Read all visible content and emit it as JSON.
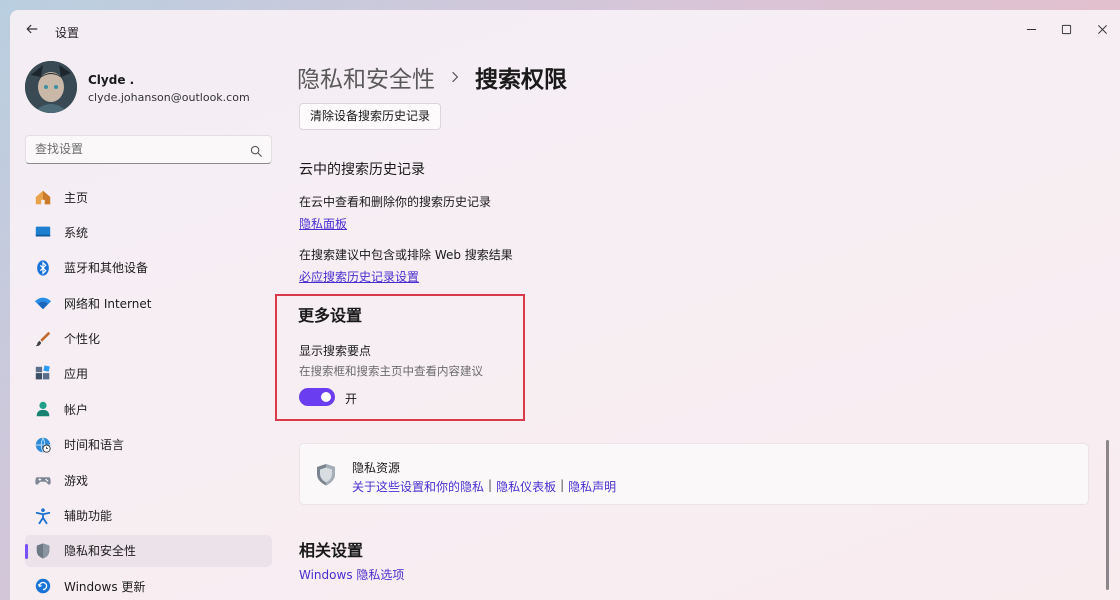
{
  "titlebar": {
    "app_title": "设置",
    "back_icon": "back-arrow-icon"
  },
  "profile": {
    "name": "Clyde .",
    "email": "clyde.johanson@outlook.com"
  },
  "search": {
    "placeholder": "查找设置"
  },
  "sidebar": {
    "items": [
      {
        "label": "主页",
        "icon": "home-icon",
        "active": false
      },
      {
        "label": "系统",
        "icon": "system-icon",
        "active": false
      },
      {
        "label": "蓝牙和其他设备",
        "icon": "bluetooth-icon",
        "active": false
      },
      {
        "label": "网络和 Internet",
        "icon": "wifi-icon",
        "active": false
      },
      {
        "label": "个性化",
        "icon": "brush-icon",
        "active": false
      },
      {
        "label": "应用",
        "icon": "apps-icon",
        "active": false
      },
      {
        "label": "帐户",
        "icon": "account-icon",
        "active": false
      },
      {
        "label": "时间和语言",
        "icon": "globe-clock-icon",
        "active": false
      },
      {
        "label": "游戏",
        "icon": "gamepad-icon",
        "active": false
      },
      {
        "label": "辅助功能",
        "icon": "accessibility-icon",
        "active": false
      },
      {
        "label": "隐私和安全性",
        "icon": "shield-icon",
        "active": true
      },
      {
        "label": "Windows 更新",
        "icon": "update-icon",
        "active": false
      }
    ]
  },
  "main": {
    "breadcrumb_parent": "隐私和安全性",
    "breadcrumb_current": "搜索权限",
    "clear_button": "清除设备搜索历史记录",
    "cloud_history_title": "云中的搜索历史记录",
    "cloud_view_text": "在云中查看和删除你的搜索历史记录",
    "privacy_dashboard_link": "隐私面板",
    "include_web_text": "在搜索建议中包含或排除 Web 搜索结果",
    "bing_history_link": "必应搜索历史记录设置",
    "more_settings_title": "更多设置",
    "highlights_title": "显示搜索要点",
    "highlights_desc": "在搜索框和搜索主页中查看内容建议",
    "highlights_toggle_state": "开",
    "privacy_resources": {
      "title": "隐私资源",
      "links": [
        "关于这些设置和你的隐私",
        "隐私仪表板",
        "隐私声明"
      ],
      "separator": "|"
    },
    "related_title": "相关设置",
    "related_link": "Windows 隐私选项"
  },
  "colors": {
    "accent": "#6a3df0",
    "link": "#4a2fd0",
    "highlight_border": "#d93a4a"
  }
}
